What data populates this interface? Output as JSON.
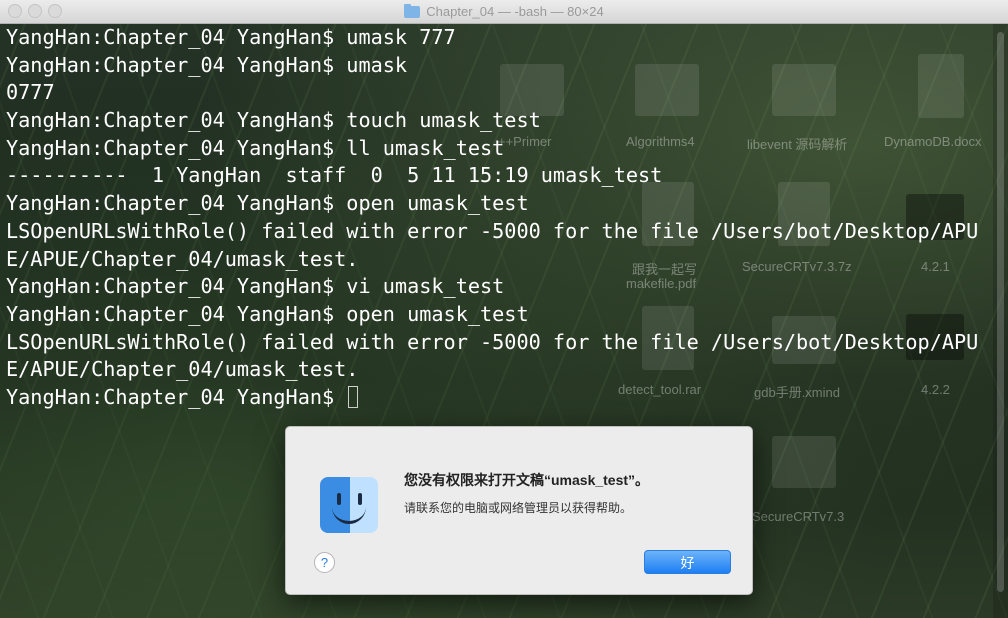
{
  "window": {
    "title": "Chapter_04 — -bash — 80×24",
    "icon": "folder-icon"
  },
  "terminal": {
    "lines": [
      "YangHan:Chapter_04 YangHan$ umask 777",
      "YangHan:Chapter_04 YangHan$ umask",
      "0777",
      "YangHan:Chapter_04 YangHan$ touch umask_test",
      "YangHan:Chapter_04 YangHan$ ll umask_test",
      "----------  1 YangHan  staff  0  5 11 15:19 umask_test",
      "YangHan:Chapter_04 YangHan$ open umask_test",
      "LSOpenURLsWithRole() failed with error -5000 for the file /Users/bot/Desktop/APU",
      "E/APUE/Chapter_04/umask_test.",
      "YangHan:Chapter_04 YangHan$ vi umask_test",
      "YangHan:Chapter_04 YangHan$ open umask_test",
      "LSOpenURLsWithRole() failed with error -5000 for the file /Users/bot/Desktop/APU",
      "E/APUE/Chapter_04/umask_test.",
      "YangHan:Chapter_04 YangHan$ "
    ]
  },
  "desktop": {
    "items": [
      {
        "label": "++Primer"
      },
      {
        "label": "Algorithms4"
      },
      {
        "label": "libevent 源码解析"
      },
      {
        "label": "DynamoDB.docx"
      },
      {
        "label": "跟我一起写"
      },
      {
        "label": "makefile.pdf"
      },
      {
        "label": "SecureCRTv7.3.7z"
      },
      {
        "label": "4.2.1"
      },
      {
        "label": "detect_tool.rar"
      },
      {
        "label": "gdb手册.xmind"
      },
      {
        "label": "4.2.2"
      },
      {
        "label": "SecureCRTv7.3"
      }
    ]
  },
  "dialog": {
    "title": "您没有权限来打开文稿“umask_test”。",
    "message": "请联系您的电脑或网络管理员以获得帮助。",
    "help_label": "?",
    "ok_label": "好",
    "icon": "finder-icon",
    "accent": "#1e7ff2"
  }
}
